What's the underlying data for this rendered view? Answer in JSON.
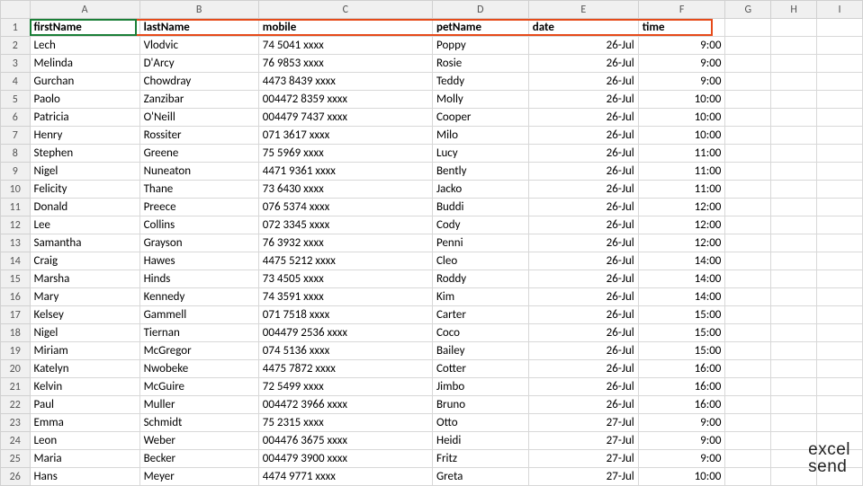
{
  "columns": [
    "A",
    "B",
    "C",
    "D",
    "E",
    "F",
    "G",
    "H",
    "I"
  ],
  "headers": {
    "A": "firstName",
    "B": "lastName",
    "C": "mobile",
    "D": "petName",
    "E": "date",
    "F": "time"
  },
  "rows": [
    {
      "n": 2,
      "A": "Lech",
      "B": "Vlodvic",
      "C": "74 5041 xxxx",
      "D": "Poppy",
      "E": "26-Jul",
      "F": "9:00"
    },
    {
      "n": 3,
      "A": "Melinda",
      "B": "D'Arcy",
      "C": "76 9853 xxxx",
      "D": "Rosie",
      "E": "26-Jul",
      "F": "9:00"
    },
    {
      "n": 4,
      "A": "Gurchan",
      "B": "Chowdray",
      "C": "4473 8439 xxxx",
      "D": "Teddy",
      "E": "26-Jul",
      "F": "9:00"
    },
    {
      "n": 5,
      "A": "Paolo",
      "B": "Zanzibar",
      "C": "004472 8359 xxxx",
      "D": "Molly",
      "E": "26-Jul",
      "F": "10:00"
    },
    {
      "n": 6,
      "A": "Patricia",
      "B": "O'Neill",
      "C": "004479 7437 xxxx",
      "D": "Cooper",
      "E": "26-Jul",
      "F": "10:00"
    },
    {
      "n": 7,
      "A": "Henry",
      "B": "Rossiter",
      "C": "071 3617 xxxx",
      "D": "Milo",
      "E": "26-Jul",
      "F": "10:00"
    },
    {
      "n": 8,
      "A": "Stephen",
      "B": "Greene",
      "C": "75 5969 xxxx",
      "D": "Lucy",
      "E": "26-Jul",
      "F": "11:00"
    },
    {
      "n": 9,
      "A": "Nigel",
      "B": "Nuneaton",
      "C": "4471 9361 xxxx",
      "D": "Bently",
      "E": "26-Jul",
      "F": "11:00"
    },
    {
      "n": 10,
      "A": "Felicity",
      "B": "Thane",
      "C": "73 6430 xxxx",
      "D": "Jacko",
      "E": "26-Jul",
      "F": "11:00"
    },
    {
      "n": 11,
      "A": "Donald",
      "B": "Preece",
      "C": "076 5374 xxxx",
      "D": "Buddi",
      "E": "26-Jul",
      "F": "12:00"
    },
    {
      "n": 12,
      "A": "Lee",
      "B": "Collins",
      "C": "072 3345 xxxx",
      "D": "Cody",
      "E": "26-Jul",
      "F": "12:00"
    },
    {
      "n": 13,
      "A": "Samantha",
      "B": "Grayson",
      "C": "76 3932 xxxx",
      "D": "Penni",
      "E": "26-Jul",
      "F": "12:00"
    },
    {
      "n": 14,
      "A": "Craig",
      "B": "Hawes",
      "C": "4475 5212 xxxx",
      "D": "Cleo",
      "E": "26-Jul",
      "F": "14:00"
    },
    {
      "n": 15,
      "A": "Marsha",
      "B": "Hinds",
      "C": "73 4505 xxxx",
      "D": "Roddy",
      "E": "26-Jul",
      "F": "14:00"
    },
    {
      "n": 16,
      "A": "Mary",
      "B": "Kennedy",
      "C": "74 3591 xxxx",
      "D": "Kim",
      "E": "26-Jul",
      "F": "14:00"
    },
    {
      "n": 17,
      "A": "Kelsey",
      "B": "Gammell",
      "C": "071 7518 xxxx",
      "D": "Carter",
      "E": "26-Jul",
      "F": "15:00"
    },
    {
      "n": 18,
      "A": "Nigel",
      "B": "Tiernan",
      "C": "004479 2536 xxxx",
      "D": "Coco",
      "E": "26-Jul",
      "F": "15:00"
    },
    {
      "n": 19,
      "A": "Miriam",
      "B": "McGregor",
      "C": "074 5136 xxxx",
      "D": "Bailey",
      "E": "26-Jul",
      "F": "15:00"
    },
    {
      "n": 20,
      "A": "Katelyn",
      "B": "Nwobeke",
      "C": "4475 7872 xxxx",
      "D": "Cotter",
      "E": "26-Jul",
      "F": "16:00"
    },
    {
      "n": 21,
      "A": "Kelvin",
      "B": "McGuire",
      "C": "72 5499 xxxx",
      "D": "Jimbo",
      "E": "26-Jul",
      "F": "16:00"
    },
    {
      "n": 22,
      "A": "Paul",
      "B": "Muller",
      "C": "004472 3966 xxxx",
      "D": "Bruno",
      "E": "26-Jul",
      "F": "16:00"
    },
    {
      "n": 23,
      "A": "Emma",
      "B": "Schmidt",
      "C": "75 2315 xxxx",
      "D": "Otto",
      "E": "27-Jul",
      "F": "9:00"
    },
    {
      "n": 24,
      "A": "Leon",
      "B": "Weber",
      "C": "004476 3675 xxxx",
      "D": "Heidi",
      "E": "27-Jul",
      "F": "9:00"
    },
    {
      "n": 25,
      "A": "Maria",
      "B": "Becker",
      "C": "004479 3900 xxxx",
      "D": "Fritz",
      "E": "27-Jul",
      "F": "9:00"
    },
    {
      "n": 26,
      "A": "Hans",
      "B": "Meyer",
      "C": "4474 9771 xxxx",
      "D": "Greta",
      "E": "27-Jul",
      "F": "10:00"
    }
  ],
  "logo": {
    "line1": "excel",
    "line2": "send"
  }
}
